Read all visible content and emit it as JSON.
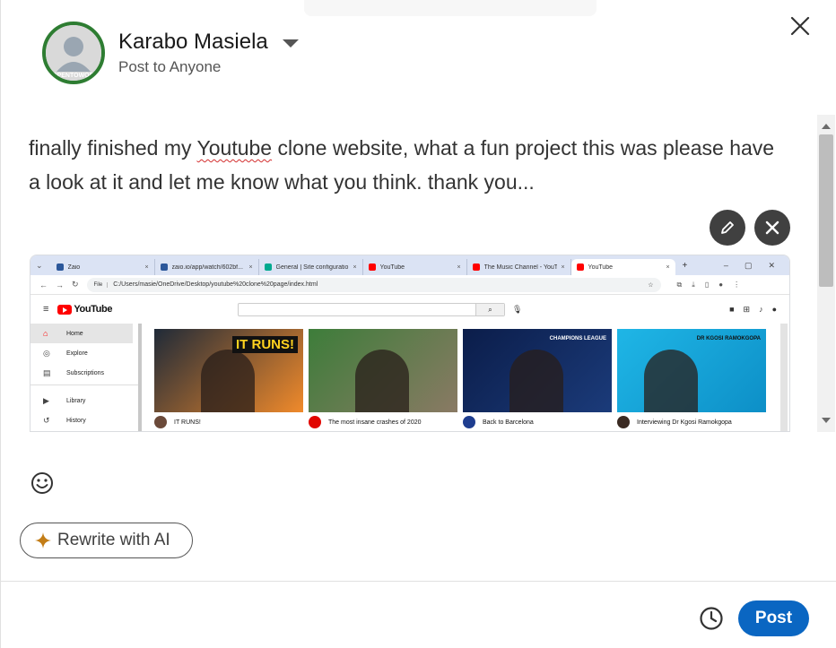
{
  "author": {
    "name": "Karabo Masiela",
    "audience": "Post to Anyone",
    "avatar_badge": "#OPENTOWORK"
  },
  "post": {
    "text_before": "finally finished my ",
    "text_flagged": "Youtube",
    "text_after": " clone website, what a fun project this was please have a look at it and let me know what you think. thank you..."
  },
  "embedded_screenshot": {
    "tabs": [
      {
        "label": "Zaio",
        "color": "#2b579a"
      },
      {
        "label": "zaio.io/app/watch/602bf...",
        "color": "#2b579a"
      },
      {
        "label": "General | Site configuratio",
        "color": "#00a98f"
      },
      {
        "label": "YouTube",
        "color": "#ff0000"
      },
      {
        "label": "The Music Channel - YouTu",
        "color": "#ff0000"
      },
      {
        "label": "YouTube",
        "color": "#ff0000"
      }
    ],
    "tab_close": "×",
    "new_tab": "+",
    "win_controls": [
      "–",
      "▢",
      "✕"
    ],
    "url_chip": "File",
    "url": "C:/Users/masie/OneDrive/Desktop/youtube%20clone%20page/index.html",
    "yt_logo": "YouTube",
    "sidebar": [
      {
        "label": "Home",
        "icon": "⌂"
      },
      {
        "label": "Explore",
        "icon": "◎"
      },
      {
        "label": "Subscriptions",
        "icon": "▤"
      },
      {
        "label": "Library",
        "icon": "▶"
      },
      {
        "label": "History",
        "icon": "↺"
      }
    ],
    "videos": [
      {
        "title": "IT RUNS!",
        "thumb_text": "IT RUNS!",
        "colors": [
          "#1f2a38",
          "#f08a2b"
        ],
        "dot": "#6b4a3a"
      },
      {
        "title": "The most insane crashes of 2020",
        "thumb_text": "",
        "colors": [
          "#3d7d3a",
          "#8a7a64"
        ],
        "dot": "#e10600"
      },
      {
        "title": "Back to Barcelona",
        "thumb_text": "CHAMPIONS LEAGUE",
        "colors": [
          "#0b1d4a",
          "#1b3b7a"
        ],
        "dot": "#1e3d8f"
      },
      {
        "title": "Interviewing Dr Kgosi Ramokgopa",
        "thumb_text": "DR KGOSI RAMOKGOPA",
        "colors": [
          "#1fb6e6",
          "#0d8fc7"
        ],
        "dot": "#3a2a22"
      }
    ]
  },
  "actions": {
    "rewrite_label": "Rewrite with AI",
    "post_label": "Post"
  },
  "colors": {
    "primary": "#0a66c2",
    "ai_spark": "#c37d16",
    "open_to_work": "#2e7d32"
  }
}
